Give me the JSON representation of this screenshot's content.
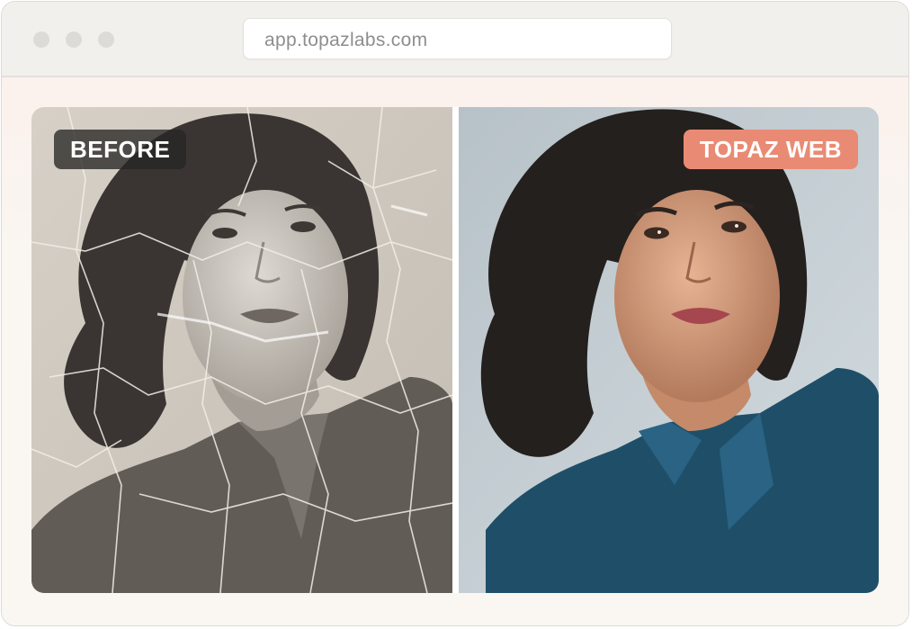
{
  "browser": {
    "url": "app.topazlabs.com"
  },
  "comparison": {
    "before_label": "BEFORE",
    "after_label": "TOPAZ WEB"
  },
  "colors": {
    "after_badge": "#e98b74",
    "window_background": "#f9f7f3"
  }
}
